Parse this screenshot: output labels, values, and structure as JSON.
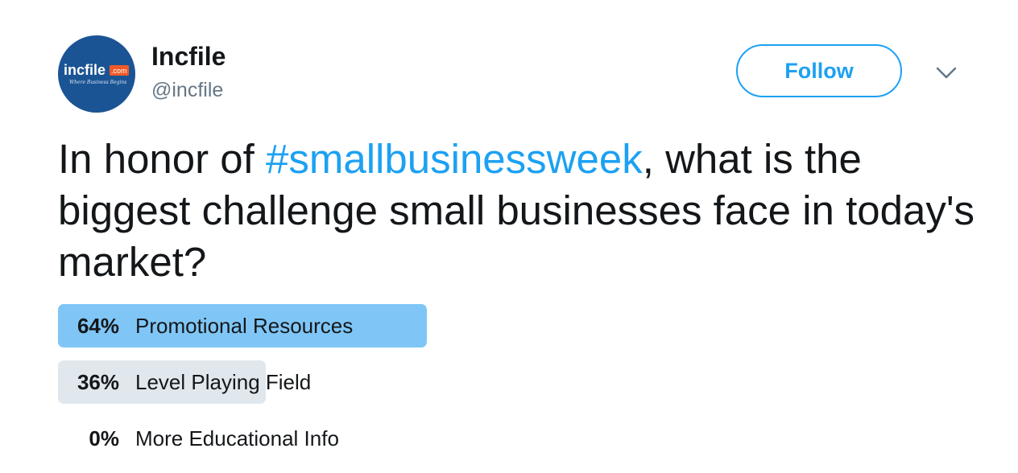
{
  "author": {
    "name": "Incfile",
    "handle": "@incfile",
    "avatar_logo_text": "incfile",
    "avatar_logo_badge": ".com",
    "avatar_tagline": "Where Business Begins"
  },
  "follow_button": {
    "label": "Follow"
  },
  "menu": {
    "icon": "chevron-down-icon"
  },
  "tweet": {
    "text_before": "In honor of ",
    "hashtag": "#smallbusinessweek",
    "text_after": ", what is the biggest challenge small businesses face in today's market?"
  },
  "poll": {
    "options": [
      {
        "percent_label": "64%",
        "percent": 64,
        "label": "Promotional Resources",
        "leader": true
      },
      {
        "percent_label": "36%",
        "percent": 36,
        "label": "Level Playing Field",
        "leader": false
      },
      {
        "percent_label": "0%",
        "percent": 0,
        "label": "More Educational Info",
        "leader": false
      }
    ]
  },
  "colors": {
    "accent": "#1da1f2",
    "poll_leader": "#7fc6f6",
    "poll_other": "#e1e8ed",
    "text": "#14171a",
    "secondary_text": "#657786",
    "avatar_bg": "#1b5494"
  }
}
